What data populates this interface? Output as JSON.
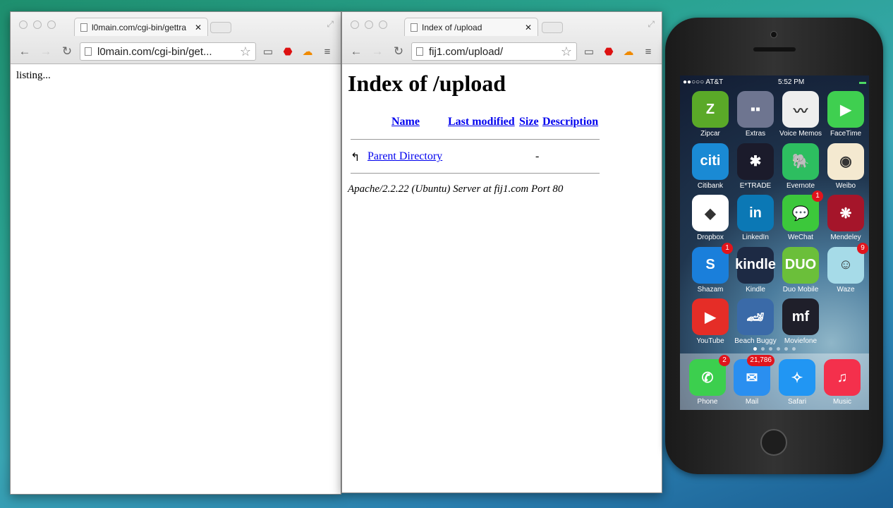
{
  "left_window": {
    "tab_title": "l0main.com/cgi-bin/gettra",
    "url": "l0main.com/cgi-bin/get...",
    "body_text": "listing..."
  },
  "right_window": {
    "tab_title": "Index of /upload",
    "url": "fij1.com/upload/",
    "heading": "Index of /upload",
    "columns": [
      "Name",
      "Last modified",
      "Size",
      "Description"
    ],
    "rows": [
      {
        "name": "Parent Directory",
        "modified": "",
        "size": "-",
        "description": ""
      }
    ],
    "footer": "Apache/2.2.22 (Ubuntu) Server at fij1.com Port 80"
  },
  "phone": {
    "carrier": "●●○○○ AT&T",
    "time": "5:52 PM",
    "apps": [
      {
        "label": "Zipcar",
        "glyph": "Z",
        "color": "#5aa928"
      },
      {
        "label": "Extras",
        "glyph": "▪▪",
        "color": "#6e7590"
      },
      {
        "label": "Voice Memos",
        "glyph": "〰",
        "color": "#eeeeee"
      },
      {
        "label": "FaceTime",
        "glyph": "▶",
        "color": "#3fcf50"
      },
      {
        "label": "Citibank",
        "glyph": "citi",
        "color": "#1a8ad4"
      },
      {
        "label": "E*TRADE",
        "glyph": "✱",
        "color": "#1b1b2b"
      },
      {
        "label": "Evernote",
        "glyph": "🐘",
        "color": "#2dbe60"
      },
      {
        "label": "Weibo",
        "glyph": "◉",
        "color": "#f4e9d0"
      },
      {
        "label": "Dropbox",
        "glyph": "◆",
        "color": "#ffffff"
      },
      {
        "label": "LinkedIn",
        "glyph": "in",
        "color": "#0b78b5"
      },
      {
        "label": "WeChat",
        "glyph": "💬",
        "color": "#3cc83b",
        "badge": "1"
      },
      {
        "label": "Mendeley",
        "glyph": "❋",
        "color": "#a5152a"
      },
      {
        "label": "Shazam",
        "glyph": "S",
        "color": "#1a7fdb",
        "badge": "1"
      },
      {
        "label": "Kindle",
        "glyph": "kindle",
        "color": "#1d2a44"
      },
      {
        "label": "Duo Mobile",
        "glyph": "DUO",
        "color": "#6bbf3a"
      },
      {
        "label": "Waze",
        "glyph": "☺",
        "color": "#a6dbe8",
        "badge": "9"
      },
      {
        "label": "YouTube",
        "glyph": "▶",
        "color": "#e52d27"
      },
      {
        "label": "Beach Buggy",
        "glyph": "🏎",
        "color": "#3a6aa8"
      },
      {
        "label": "Moviefone",
        "glyph": "mf",
        "color": "#1f1f2a"
      }
    ],
    "dock": [
      {
        "label": "Phone",
        "glyph": "✆",
        "color": "#3ccf4e",
        "badge": "2"
      },
      {
        "label": "Mail",
        "glyph": "✉",
        "color": "#2a8ff0",
        "badge": "21,786"
      },
      {
        "label": "Safari",
        "glyph": "✧",
        "color": "#2196f3"
      },
      {
        "label": "Music",
        "glyph": "♫",
        "color": "#f4304c"
      }
    ]
  }
}
